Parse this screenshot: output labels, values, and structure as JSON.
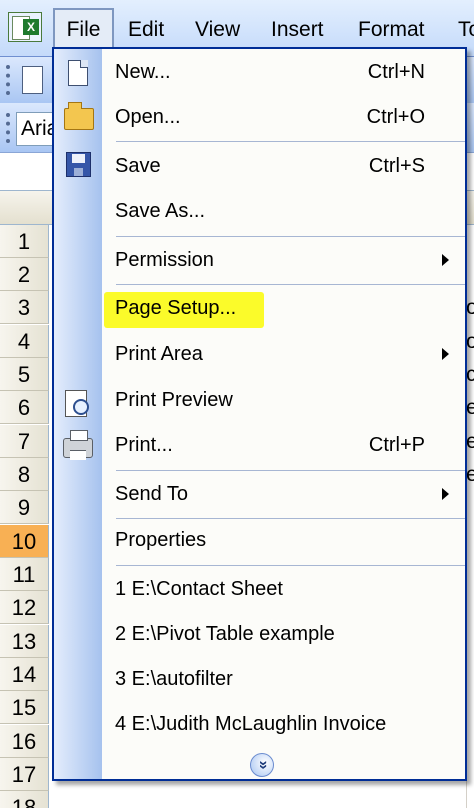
{
  "menubar": {
    "items": [
      "File",
      "Edit",
      "View",
      "Insert",
      "Format",
      "To"
    ]
  },
  "toolbar": {
    "font_name": "Aria"
  },
  "grid": {
    "row_numbers": [
      "1",
      "2",
      "3",
      "4",
      "5",
      "6",
      "7",
      "8",
      "9",
      "10",
      "11",
      "12",
      "13",
      "14",
      "15",
      "16",
      "17",
      "18"
    ],
    "active_row": "10",
    "right_edge_chars": [
      "o",
      "o",
      "c",
      "e",
      "e",
      "e"
    ]
  },
  "file_menu": {
    "new": {
      "label": "New...",
      "shortcut": "Ctrl+N"
    },
    "open": {
      "label": "Open...",
      "shortcut": "Ctrl+O"
    },
    "save": {
      "label": "Save",
      "shortcut": "Ctrl+S"
    },
    "save_as": {
      "label": "Save As..."
    },
    "permission": {
      "label": "Permission"
    },
    "page_setup": {
      "label": "Page Setup..."
    },
    "print_area": {
      "label": "Print Area"
    },
    "print_preview": {
      "label": "Print Preview"
    },
    "print": {
      "label": "Print...",
      "shortcut": "Ctrl+P"
    },
    "send_to": {
      "label": "Send To"
    },
    "properties": {
      "label": "Properties"
    },
    "recent": [
      "1 E:\\Contact Sheet",
      "2 E:\\Pivot Table example",
      "3 E:\\autofilter",
      "4 E:\\Judith McLaughlin Invoice"
    ],
    "expand_glyph": "»"
  },
  "colors": {
    "highlight": "#fbfb2a",
    "menu_border": "#002d96",
    "active_row": "#f8b054"
  }
}
